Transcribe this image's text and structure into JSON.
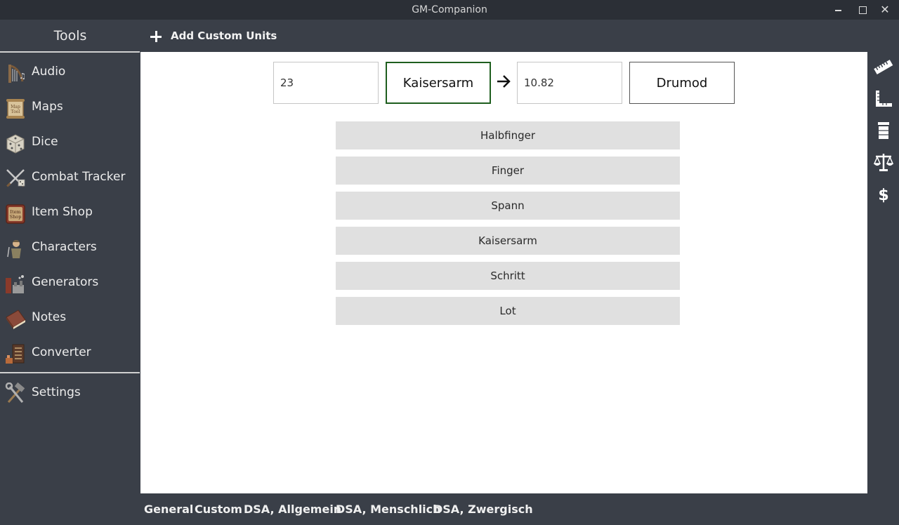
{
  "window": {
    "title": "GM-Companion"
  },
  "sidebar": {
    "title": "Tools",
    "items": [
      {
        "label": "Audio",
        "icon": "harp-icon"
      },
      {
        "label": "Maps",
        "icon": "map-scroll-icon"
      },
      {
        "label": "Dice",
        "icon": "dice-icon"
      },
      {
        "label": "Combat Tracker",
        "icon": "crossed-swords-icon"
      },
      {
        "label": "Item Shop",
        "icon": "item-shop-sign-icon"
      },
      {
        "label": "Characters",
        "icon": "character-icon"
      },
      {
        "label": "Generators",
        "icon": "generators-icon"
      },
      {
        "label": "Notes",
        "icon": "notebook-icon"
      },
      {
        "label": "Converter",
        "icon": "converter-icon"
      }
    ],
    "settings": {
      "label": "Settings",
      "icon": "hammer-wrench-icon"
    }
  },
  "toolbar": {
    "add_custom_units_label": "Add Custom Units"
  },
  "converter": {
    "from_value": "23",
    "from_unit": "Kaisersarm",
    "to_value": "10.82",
    "to_unit": "Drumod",
    "units": [
      "Halbfinger",
      "Finger",
      "Spann",
      "Kaisersarm",
      "Schritt",
      "Lot"
    ]
  },
  "right_bar": {
    "icons": [
      "ruler-icon",
      "area-square-icon",
      "volume-cup-icon",
      "scale-weight-icon",
      "dollar-icon"
    ]
  },
  "categories": [
    "General",
    "Custom",
    "DSA, Allgemein",
    "DSA, Menschlich",
    "DSA, Zwergisch"
  ],
  "colors": {
    "background": "#3a3f48",
    "titlebar": "#2b2f36",
    "panel": "#ffffff",
    "selected_unit_border": "#1e5e1e",
    "unit_button": "#e0e0e0"
  }
}
